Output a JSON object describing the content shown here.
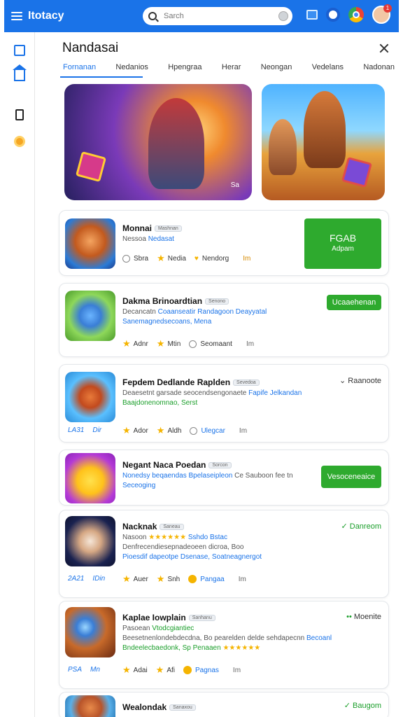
{
  "app": {
    "title": "Itotacy",
    "search_placeholder": "Sarch",
    "avatar_badge": "1"
  },
  "panel": {
    "title": "Nandasai",
    "tabs": [
      "Fornanan",
      "Nedanios",
      "Hpengraa",
      "Herar",
      "Neongan",
      "Vedelans",
      "Nadonan"
    ],
    "active_tab": 0
  },
  "banner": {
    "caption": "Sa"
  },
  "cards": [
    {
      "name": "Monnai",
      "tag": "Mashnan",
      "sub1": "Nessoa",
      "sub1_blue": "Nedasat",
      "meta": [
        "Sbra",
        "Nedia",
        "Nendorg"
      ],
      "size": "Im",
      "button_line1": "FGAB",
      "button_line2": "Adpam"
    },
    {
      "name": "Dakma Brinoardtian",
      "tag": "Senono",
      "sub1": "Decancatn",
      "sub1_blue": "Coaanseatir Randagoon Deayyatal",
      "sub2_blue": "Sanemagnedsecoans, Mena",
      "meta": [
        "Adnr",
        "Mtin",
        "Seomaant"
      ],
      "size": "Im",
      "button": "Ucaaehenan"
    },
    {
      "name": "Fepdem Dedlande Raplden",
      "tag": "Sevedoa",
      "sub1": "Deaesetnt garsade seocendsengonaete",
      "sub1_blue": "Fapife Jelkandan",
      "sub2_green": "Baajdonenomnao, Serst",
      "meta": [
        "Ador",
        "Aldh",
        "Ulegcar"
      ],
      "size": "Im",
      "stats": [
        "LA31",
        "Dir"
      ],
      "status": "Raanoote"
    },
    {
      "name": "Negant Naca Poedan",
      "tag": "Sorcon",
      "sub1_blue": "Nonedsy beqaendas Bpelaseipleon",
      "sub1": "Ce Sauboon fee tn",
      "sub2_blue": "Seceoging",
      "button": "Vesoceneaice"
    },
    {
      "name": "Nacknak",
      "tag": "Saneau",
      "sub1": "Nasoon",
      "sub1_blue": "Sshdo Bstac",
      "sub2": "Denfrecendiesepnadeoeen dicroa, Boo",
      "sub3_blue": "Pioesdif dapeotpe Dsenase, Soatneagnergot",
      "meta": [
        "Auer",
        "Snh",
        "Pangaa"
      ],
      "size": "Im",
      "stats": [
        "2A21",
        "IDin"
      ],
      "status": "Danreom"
    },
    {
      "name": "Kaplae Iowplain",
      "tag": "Sanhanu",
      "sub1": "Pasoean",
      "sub1_green": "Vtodcgiantiec",
      "sub2": "Beesetnenlondebdecdna, Bo pearelden delde sehdapecnn",
      "sub2_blue": "Becoanl",
      "sub3_green": "Bndeelecbaedonk, Sp Penaaen",
      "meta": [
        "Adai",
        "Afi",
        "Pagnas"
      ],
      "size": "Im",
      "stats": [
        "PSA",
        "Mn"
      ],
      "status": "Moenite"
    },
    {
      "name": "Wealondak",
      "tag": "Sanaxou",
      "status": "Baugom"
    }
  ],
  "colors": {
    "accent": "#1a73e8",
    "install": "#2eaa2e",
    "star": "#f5b400"
  }
}
